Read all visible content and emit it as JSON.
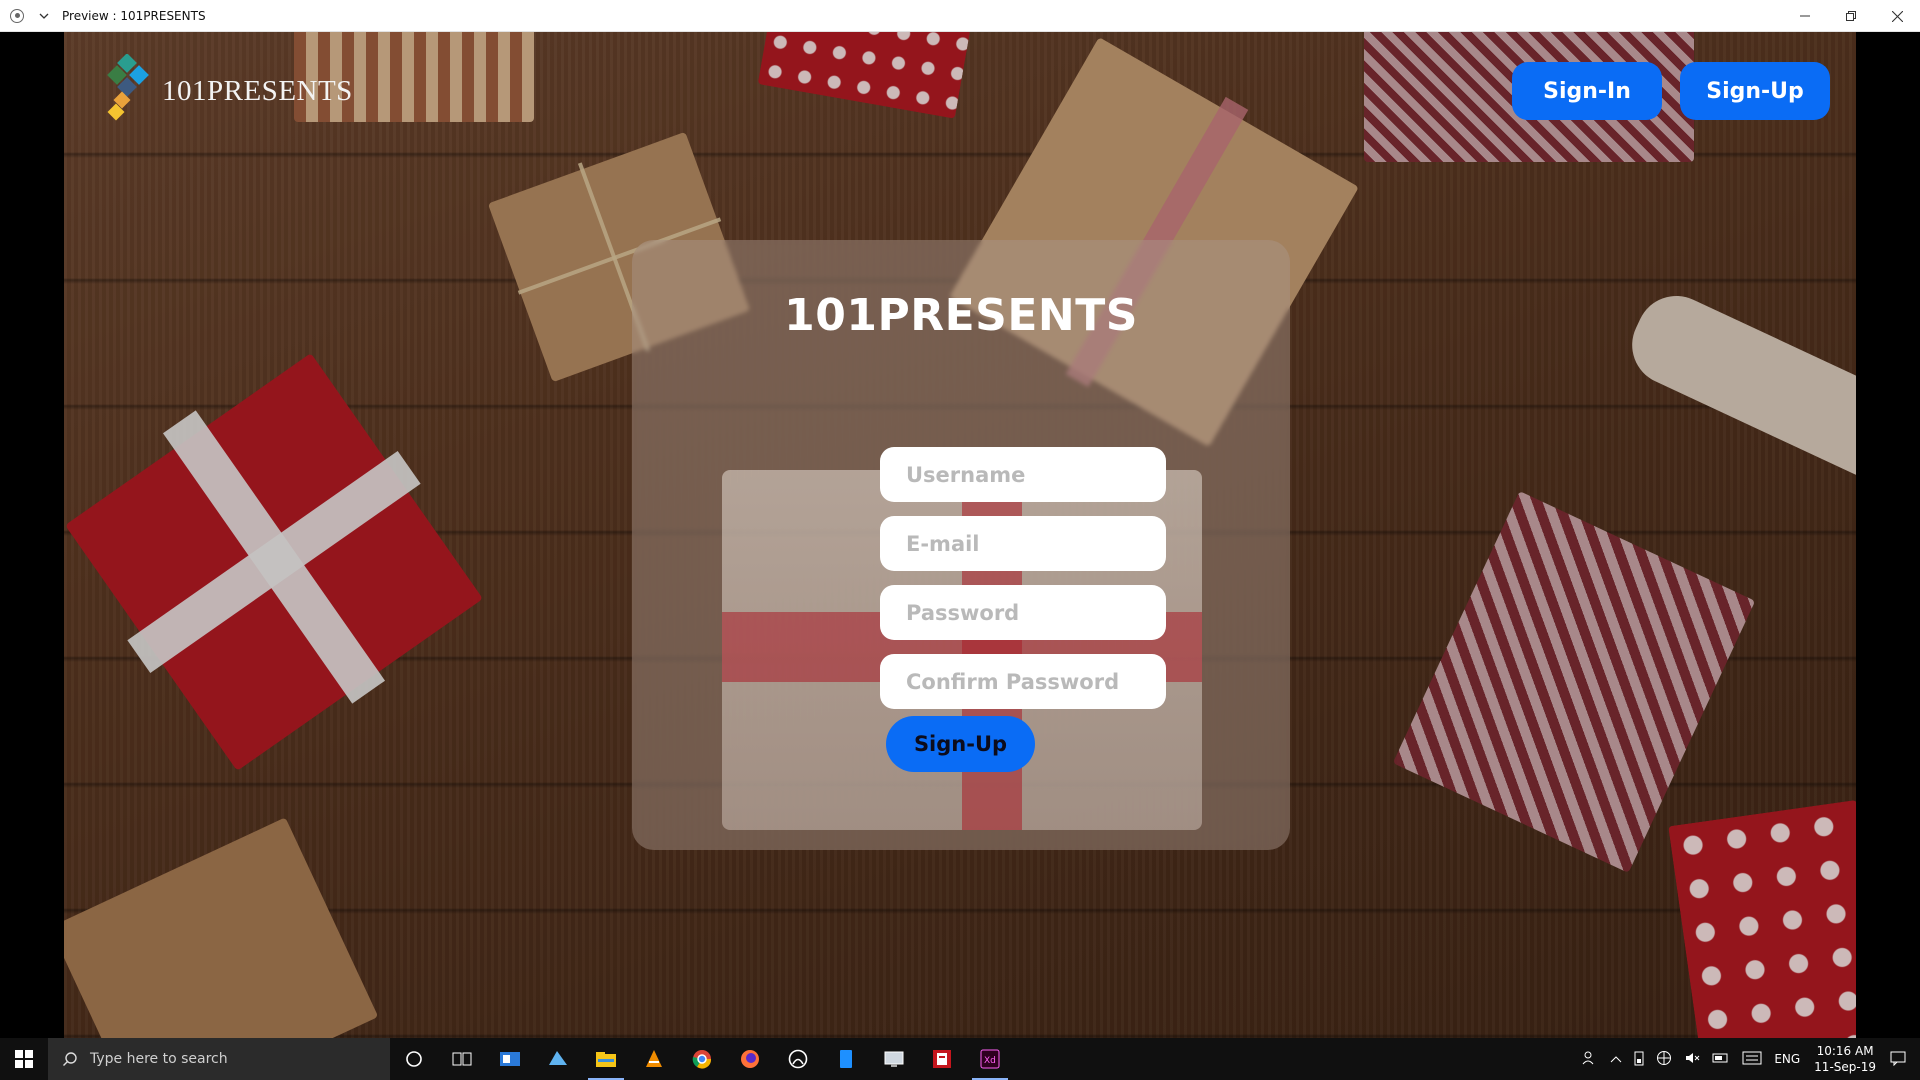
{
  "window": {
    "title": "Preview : 101PRESENTS",
    "icons": {
      "app": "record-icon",
      "menu": "chevron-down-icon",
      "minimize": "minimize-icon",
      "restore": "restore-icon",
      "close": "close-icon"
    }
  },
  "header": {
    "logo_text": "101PRESENTS",
    "signin_label": "Sign-In",
    "signup_label": "Sign-Up"
  },
  "form": {
    "title": "101PRESENTS",
    "username_placeholder": "Username",
    "email_placeholder": "E-mail",
    "password_placeholder": "Password",
    "confirm_placeholder": "Confirm Password",
    "submit_label": "Sign-Up"
  },
  "colors": {
    "accent": "#0a6cf5",
    "panel": "#aa968c"
  },
  "taskbar": {
    "search_placeholder": "Type here to search",
    "apps": [
      "cortana-icon",
      "task-view-icon",
      "outlook-icon",
      "azure-icon",
      "file-explorer-icon",
      "vlc-icon",
      "chrome-icon",
      "firefox-icon",
      "xbox-icon",
      "phone-icon",
      "remote-desktop-icon",
      "readability-icon",
      "adobe-xd-icon"
    ],
    "tray": {
      "lang": "ENG",
      "time": "10:16 AM",
      "date": "11-Sep-19"
    }
  }
}
